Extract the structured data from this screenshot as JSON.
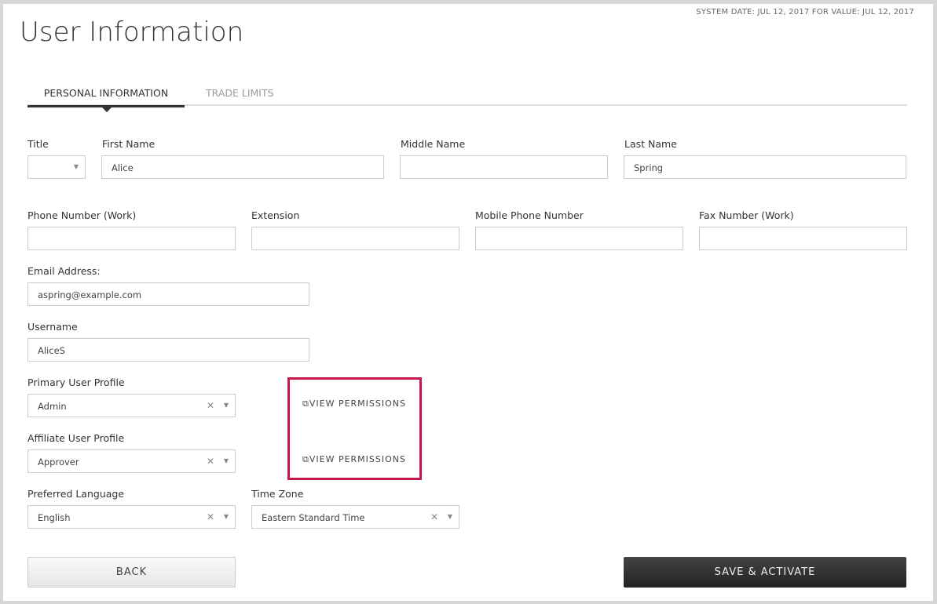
{
  "system_date": "SYSTEM DATE: JUL 12, 2017 FOR VALUE: JUL 12, 2017",
  "page_title": "User Information",
  "tabs": [
    "PERSONAL INFORMATION",
    "TRADE LIMITS"
  ],
  "fields": {
    "title": {
      "label": "Title",
      "value": ""
    },
    "first_name": {
      "label": "First Name",
      "value": "Alice"
    },
    "middle_name": {
      "label": "Middle Name",
      "value": ""
    },
    "last_name": {
      "label": "Last Name",
      "value": "Spring"
    },
    "phone_work": {
      "label": "Phone Number (Work)",
      "value": ""
    },
    "extension": {
      "label": "Extension",
      "value": ""
    },
    "mobile": {
      "label": "Mobile Phone Number",
      "value": ""
    },
    "fax": {
      "label": "Fax Number (Work)",
      "value": ""
    },
    "email": {
      "label": "Email Address:",
      "value": "aspring@example.com"
    },
    "username": {
      "label": "Username",
      "value": "AliceS"
    },
    "primary_profile": {
      "label": "Primary User Profile",
      "value": "Admin"
    },
    "affiliate_profile": {
      "label": "Affiliate User Profile",
      "value": "Approver"
    },
    "language": {
      "label": "Preferred Language",
      "value": "English"
    },
    "timezone": {
      "label": "Time Zone",
      "value": "Eastern Standard Time"
    }
  },
  "view_permissions": "VIEW PERMISSIONS",
  "clear": "✕",
  "buttons": {
    "back": "BACK",
    "save": "SAVE & ACTIVATE"
  },
  "accent": "#c4174a"
}
